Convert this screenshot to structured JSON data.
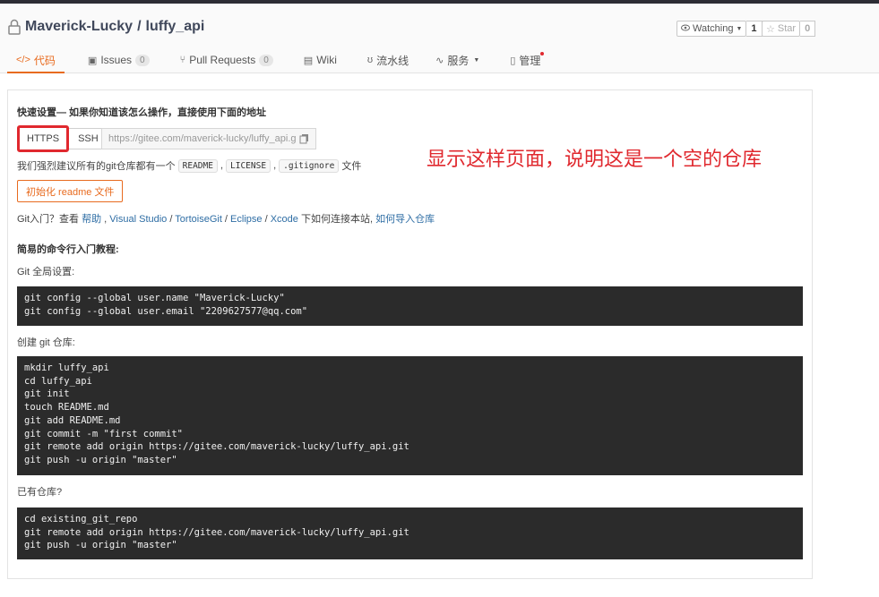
{
  "repo": {
    "owner": "Maverick-Lucky",
    "separator": "/",
    "name": "luffy_api",
    "watch_label": "Watching",
    "watch_count": "1",
    "star_label": "Star",
    "star_count": "0"
  },
  "tabs": [
    {
      "label": "代码",
      "icon": "code-icon",
      "active": true
    },
    {
      "label": "Issues",
      "icon": "issues-icon",
      "badge": "0"
    },
    {
      "label": "Pull Requests",
      "icon": "pull-request-icon",
      "badge": "0"
    },
    {
      "label": "Wiki",
      "icon": "wiki-icon"
    },
    {
      "label": "流水线",
      "icon": "pipeline-icon"
    },
    {
      "label": "服务",
      "icon": "service-icon",
      "dropdown": true
    },
    {
      "label": "管理",
      "icon": "manage-icon",
      "dot": true
    }
  ],
  "quick_setup": {
    "title": "快速设置— 如果你知道该怎么操作，直接使用下面的地址",
    "https_label": "HTTPS",
    "ssh_label": "SSH",
    "url": "https://gitee.com/maverick-lucky/luffy_api.g",
    "tip_prefix": "我们强烈建议所有的git仓库都有一个",
    "tip_chips": [
      "README",
      "LICENSE",
      ".gitignore"
    ],
    "tip_suffix": "文件",
    "init_button": "初始化 readme 文件",
    "gitintro_prefix": "Git入门？查看",
    "gitintro_links": [
      "帮助",
      "Visual Studio",
      "TortoiseGit",
      "Eclipse",
      "Xcode"
    ],
    "gitintro_middle": "下如何连接本站,",
    "gitintro_last_link": "如何导入仓库"
  },
  "tutorial": {
    "title": "简易的命令行入门教程:",
    "global_label": "Git 全局设置:",
    "global_code": "git config --global user.name \"Maverick-Lucky\"\ngit config --global user.email \"2209627577@qq.com\"",
    "create_label": "创建 git 仓库:",
    "create_code": "mkdir luffy_api\ncd luffy_api\ngit init\ntouch README.md\ngit add README.md\ngit commit -m \"first commit\"\ngit remote add origin https://gitee.com/maverick-lucky/luffy_api.git\ngit push -u origin \"master\"",
    "existing_label": "已有仓库?",
    "existing_code": "cd existing_git_repo\ngit remote add origin https://gitee.com/maverick-lucky/luffy_api.git\ngit push -u origin \"master\""
  },
  "annotation": "显示这样页面，说明这是一个空的仓库",
  "colors": {
    "accent": "#e86b1f",
    "annotation": "#e0282e",
    "code_bg": "#2b2b2b"
  }
}
